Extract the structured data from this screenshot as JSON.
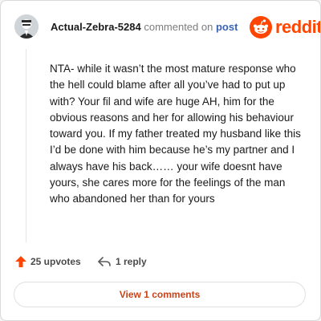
{
  "comment": {
    "username": "Actual-Zebra-5284",
    "action_text": "commented on",
    "post_link": "post",
    "body": "NTA- while it wasn’t the most mature response who the hell could blame after all you’ve had to put up with? Your fil and wife are huge AH, him for the obvious reasons and her for allowing his behaviour toward you. If my father treated my husband like this I’d be done with him because he’s my partner and I always have his back…… your wife doesnt have yours, she cares more for the feelings of the man who abandoned her than for yours"
  },
  "brand": {
    "name": "reddit",
    "icon": "reddit-logo-icon",
    "color": "#ff4500"
  },
  "footer": {
    "upvotes": "25 upvotes",
    "replies": "1 reply",
    "view_comments": "View 1 comments"
  },
  "colors": {
    "accent": "#ff4500",
    "link": "#3a63b0",
    "button_text": "#c7441a"
  }
}
